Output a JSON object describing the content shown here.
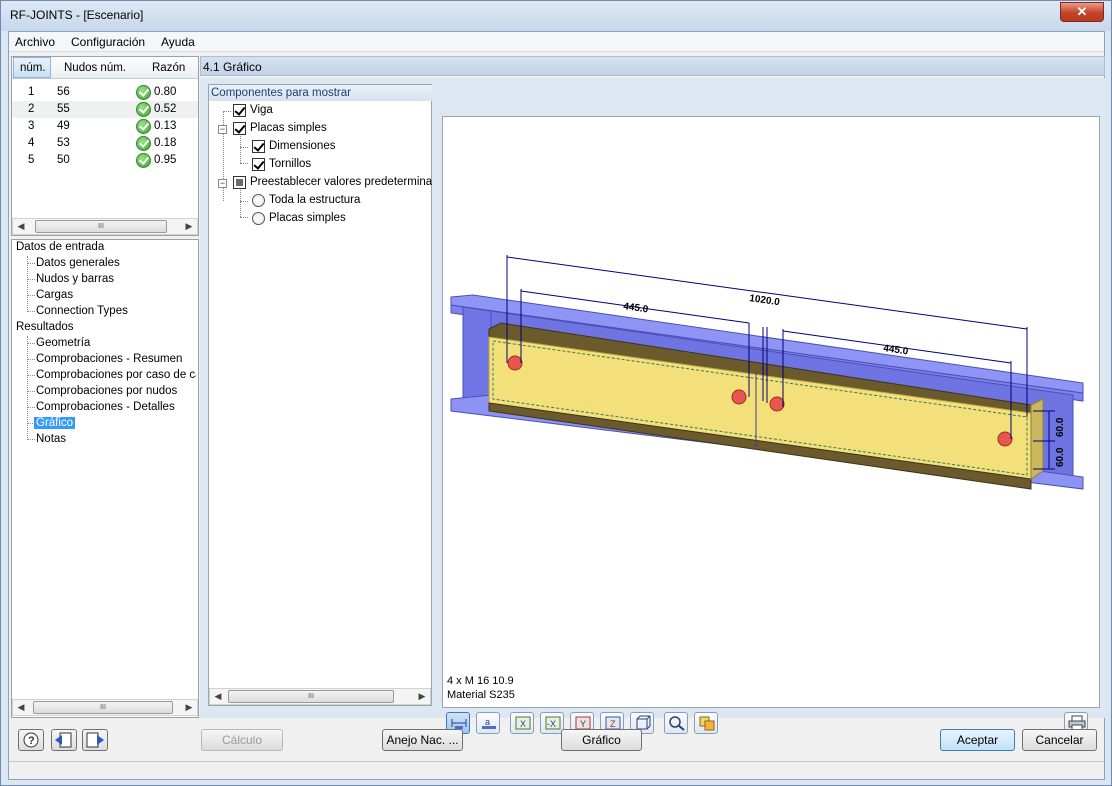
{
  "window": {
    "title": "RF-JOINTS - [Escenario]",
    "close": "✕"
  },
  "menu": [
    "Archivo",
    "Configuración",
    "Ayuda"
  ],
  "joint_table": {
    "headers": [
      "núm.",
      "Nudos núm.",
      "Razón"
    ],
    "rows": [
      {
        "num": "1",
        "nodes": "56",
        "ratio": "0.80"
      },
      {
        "num": "2",
        "nodes": "55",
        "ratio": "0.52"
      },
      {
        "num": "3",
        "nodes": "49",
        "ratio": "0.13"
      },
      {
        "num": "4",
        "nodes": "53",
        "ratio": "0.18"
      },
      {
        "num": "5",
        "nodes": "50",
        "ratio": "0.95"
      }
    ]
  },
  "nav": {
    "input_group": "Datos de entrada",
    "input_items": [
      "Datos generales",
      "Nudos y barras",
      "Cargas",
      "Connection Types"
    ],
    "results_group": "Resultados",
    "result_items": [
      "Geometría",
      "Comprobaciones - Resumen",
      "Comprobaciones por caso de carga",
      "Comprobaciones por nudos",
      "Comprobaciones - Detalles",
      "Gráfico",
      "Notas"
    ],
    "selected": "Gráfico"
  },
  "section_title": "4.1 Gráfico",
  "components": {
    "title": "Componentes para mostrar",
    "viga": "Viga",
    "placas": "Placas simples",
    "dimensiones": "Dimensiones",
    "tornillos": "Tornillos",
    "preset": "Preestablecer valores predeterminados",
    "toda": "Toda la estructura",
    "placas_radio": "Placas simples"
  },
  "graphic": {
    "dim_total": "1020.0",
    "dim_left": "445.0",
    "dim_right": "445.0",
    "dim_v1": "60.0",
    "dim_v2": "60.0",
    "info_line1": "4 x M 16 10.9",
    "info_line2": "Material S235"
  },
  "buttons": {
    "calculo": "Cálculo",
    "anejo": "Anejo Nac. ...",
    "grafico": "Gráfico",
    "aceptar": "Aceptar",
    "cancelar": "Cancelar"
  },
  "scroll_grip": "III",
  "colors": {
    "beam": "#7b80f0",
    "plate": "#f4e07a",
    "bolt": "#e8574f",
    "selection": "#3399ff"
  }
}
